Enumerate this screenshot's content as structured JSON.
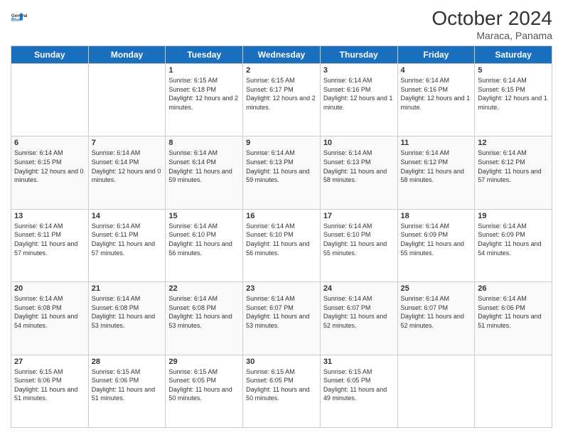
{
  "header": {
    "logo_line1": "General",
    "logo_line2": "Blue",
    "month": "October 2024",
    "location": "Maraca, Panama"
  },
  "days_of_week": [
    "Sunday",
    "Monday",
    "Tuesday",
    "Wednesday",
    "Thursday",
    "Friday",
    "Saturday"
  ],
  "weeks": [
    [
      {
        "day": "",
        "info": ""
      },
      {
        "day": "",
        "info": ""
      },
      {
        "day": "1",
        "info": "Sunrise: 6:15 AM\nSunset: 6:18 PM\nDaylight: 12 hours and 2 minutes."
      },
      {
        "day": "2",
        "info": "Sunrise: 6:15 AM\nSunset: 6:17 PM\nDaylight: 12 hours and 2 minutes."
      },
      {
        "day": "3",
        "info": "Sunrise: 6:14 AM\nSunset: 6:16 PM\nDaylight: 12 hours and 1 minute."
      },
      {
        "day": "4",
        "info": "Sunrise: 6:14 AM\nSunset: 6:16 PM\nDaylight: 12 hours and 1 minute."
      },
      {
        "day": "5",
        "info": "Sunrise: 6:14 AM\nSunset: 6:15 PM\nDaylight: 12 hours and 1 minute."
      }
    ],
    [
      {
        "day": "6",
        "info": "Sunrise: 6:14 AM\nSunset: 6:15 PM\nDaylight: 12 hours and 0 minutes."
      },
      {
        "day": "7",
        "info": "Sunrise: 6:14 AM\nSunset: 6:14 PM\nDaylight: 12 hours and 0 minutes."
      },
      {
        "day": "8",
        "info": "Sunrise: 6:14 AM\nSunset: 6:14 PM\nDaylight: 11 hours and 59 minutes."
      },
      {
        "day": "9",
        "info": "Sunrise: 6:14 AM\nSunset: 6:13 PM\nDaylight: 11 hours and 59 minutes."
      },
      {
        "day": "10",
        "info": "Sunrise: 6:14 AM\nSunset: 6:13 PM\nDaylight: 11 hours and 58 minutes."
      },
      {
        "day": "11",
        "info": "Sunrise: 6:14 AM\nSunset: 6:12 PM\nDaylight: 11 hours and 58 minutes."
      },
      {
        "day": "12",
        "info": "Sunrise: 6:14 AM\nSunset: 6:12 PM\nDaylight: 11 hours and 57 minutes."
      }
    ],
    [
      {
        "day": "13",
        "info": "Sunrise: 6:14 AM\nSunset: 6:11 PM\nDaylight: 11 hours and 57 minutes."
      },
      {
        "day": "14",
        "info": "Sunrise: 6:14 AM\nSunset: 6:11 PM\nDaylight: 11 hours and 57 minutes."
      },
      {
        "day": "15",
        "info": "Sunrise: 6:14 AM\nSunset: 6:10 PM\nDaylight: 11 hours and 56 minutes."
      },
      {
        "day": "16",
        "info": "Sunrise: 6:14 AM\nSunset: 6:10 PM\nDaylight: 11 hours and 56 minutes."
      },
      {
        "day": "17",
        "info": "Sunrise: 6:14 AM\nSunset: 6:10 PM\nDaylight: 11 hours and 55 minutes."
      },
      {
        "day": "18",
        "info": "Sunrise: 6:14 AM\nSunset: 6:09 PM\nDaylight: 11 hours and 55 minutes."
      },
      {
        "day": "19",
        "info": "Sunrise: 6:14 AM\nSunset: 6:09 PM\nDaylight: 11 hours and 54 minutes."
      }
    ],
    [
      {
        "day": "20",
        "info": "Sunrise: 6:14 AM\nSunset: 6:08 PM\nDaylight: 11 hours and 54 minutes."
      },
      {
        "day": "21",
        "info": "Sunrise: 6:14 AM\nSunset: 6:08 PM\nDaylight: 11 hours and 53 minutes."
      },
      {
        "day": "22",
        "info": "Sunrise: 6:14 AM\nSunset: 6:08 PM\nDaylight: 11 hours and 53 minutes."
      },
      {
        "day": "23",
        "info": "Sunrise: 6:14 AM\nSunset: 6:07 PM\nDaylight: 11 hours and 53 minutes."
      },
      {
        "day": "24",
        "info": "Sunrise: 6:14 AM\nSunset: 6:07 PM\nDaylight: 11 hours and 52 minutes."
      },
      {
        "day": "25",
        "info": "Sunrise: 6:14 AM\nSunset: 6:07 PM\nDaylight: 11 hours and 52 minutes."
      },
      {
        "day": "26",
        "info": "Sunrise: 6:14 AM\nSunset: 6:06 PM\nDaylight: 11 hours and 51 minutes."
      }
    ],
    [
      {
        "day": "27",
        "info": "Sunrise: 6:15 AM\nSunset: 6:06 PM\nDaylight: 11 hours and 51 minutes."
      },
      {
        "day": "28",
        "info": "Sunrise: 6:15 AM\nSunset: 6:06 PM\nDaylight: 11 hours and 51 minutes."
      },
      {
        "day": "29",
        "info": "Sunrise: 6:15 AM\nSunset: 6:05 PM\nDaylight: 11 hours and 50 minutes."
      },
      {
        "day": "30",
        "info": "Sunrise: 6:15 AM\nSunset: 6:05 PM\nDaylight: 11 hours and 50 minutes."
      },
      {
        "day": "31",
        "info": "Sunrise: 6:15 AM\nSunset: 6:05 PM\nDaylight: 11 hours and 49 minutes."
      },
      {
        "day": "",
        "info": ""
      },
      {
        "day": "",
        "info": ""
      }
    ]
  ]
}
